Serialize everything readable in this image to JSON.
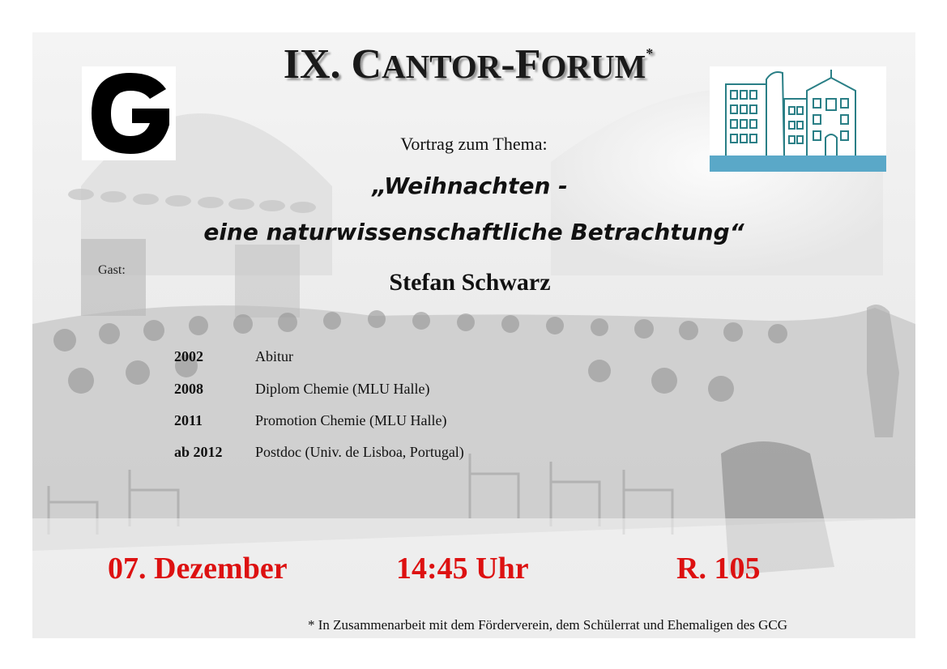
{
  "event": {
    "title_parts": {
      "roman": "IX.",
      "c_initial": "C",
      "c_rest": "ANTOR",
      "dash": "-",
      "f_initial": "F",
      "f_rest": "ORUM",
      "star": "*"
    },
    "subtitle": "Vortrag zum Thema:",
    "topic_line1": "„Weihnachten -",
    "topic_line2": "eine naturwissenschaftliche Betrachtung“"
  },
  "guest": {
    "label": "Gast:",
    "name": "Stefan Schwarz",
    "cv": [
      {
        "year": "2002",
        "text": "Abitur"
      },
      {
        "year": "2008",
        "text": "Diplom Chemie (MLU Halle)"
      },
      {
        "year": "2011",
        "text": "Promotion Chemie (MLU Halle)"
      },
      {
        "year": "ab 2012",
        "text": "Postdoc (Univ. de Lisboa, Portugal)"
      }
    ]
  },
  "schedule": {
    "date": "07. Dezember",
    "time": "14:45 Uhr",
    "room": "R. 105"
  },
  "footnote": "* In Zusammenarbeit mit dem Förderverein, dem Schülerrat und Ehemaligen des GCG",
  "colors": {
    "accent_red": "#dd1111",
    "logo_teal": "#2a7f86",
    "logo_band": "#5aa8c8"
  },
  "icons": {
    "left_logo": "school-g-logo",
    "right_logo": "school-building-logo"
  }
}
